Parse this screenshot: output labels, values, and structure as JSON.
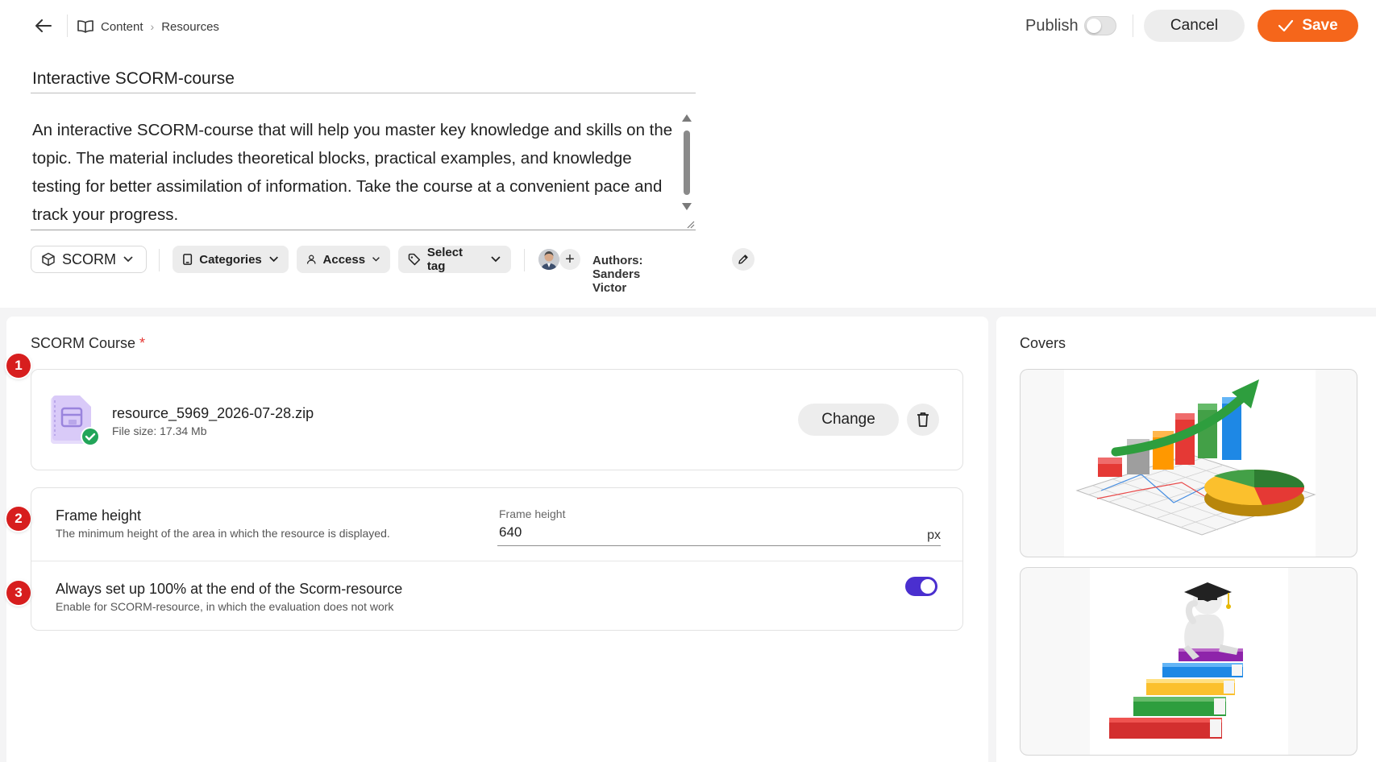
{
  "header": {
    "breadcrumb": [
      "Content",
      "Resources"
    ],
    "publish_label": "Publish",
    "publish_on": false,
    "cancel_label": "Cancel",
    "save_label": "Save",
    "accent_color": "#f5661b"
  },
  "resource": {
    "title": "Interactive SCORM-course",
    "description": "An interactive SCORM-course that will help you master key knowledge and skills on the topic. The material includes theoretical blocks, practical examples, and knowledge testing for better assimilation of information. Take the course at a convenient pace and track your progress."
  },
  "toolbar": {
    "type_label": "SCORM",
    "categories_label": "Categories",
    "access_label": "Access",
    "tag_label": "Select tag",
    "authors_label": "Authors: Sanders Victor"
  },
  "scorm": {
    "section_label": "SCORM Course",
    "required_mark": "*",
    "file_name": "resource_5969_2026-07-28.zip",
    "file_size": "File size: 17.34 Mb",
    "change_label": "Change"
  },
  "settings": {
    "frame_height": {
      "title": "Frame height",
      "description": "The minimum height of the area in which the resource is displayed.",
      "input_label": "Frame height",
      "value": "640",
      "unit": "px"
    },
    "always_100": {
      "title": "Always set up 100% at the end of the Scorm-resource",
      "description": "Enable for SCORM-resource, in which the evaluation does not work",
      "enabled": true,
      "toggle_color": "#4a2fcf"
    }
  },
  "badges": [
    "1",
    "2",
    "3"
  ],
  "covers": {
    "label": "Covers",
    "items": [
      "bar-chart-cover-image",
      "graduate-books-cover-image"
    ]
  }
}
